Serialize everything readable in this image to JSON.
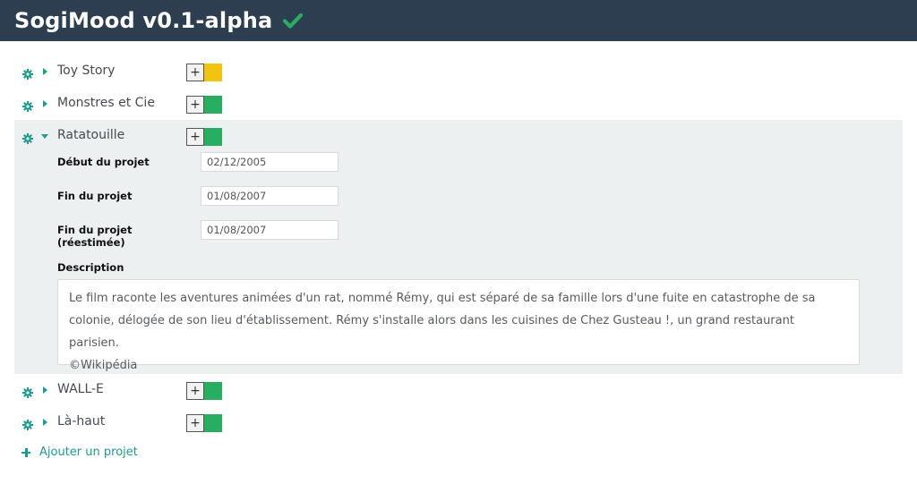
{
  "app": {
    "title": "SogiMood v0.1-alpha",
    "status_icon": "check-icon",
    "status_color": "#27ae60",
    "header_bg": "#2c3e50"
  },
  "projects": [
    {
      "name": "Toy Story",
      "expanded": false,
      "mood_color": "#f1c40f",
      "add_label": "+"
    },
    {
      "name": "Monstres et Cie",
      "expanded": false,
      "mood_color": "#27ae60",
      "add_label": "+"
    },
    {
      "name": "Ratatouille",
      "expanded": true,
      "mood_color": "#27ae60",
      "add_label": "+",
      "fields": [
        {
          "label": "Début du projet",
          "value": "02/12/2005"
        },
        {
          "label": "Fin du projet",
          "value": "01/08/2007"
        },
        {
          "label_line1": "Fin du projet",
          "label_line2": "(réestimée)",
          "value": "01/08/2007"
        }
      ],
      "description_label": "Description",
      "description_lines": [
        "Le film raconte les aventures animées d'un rat, nommé Rémy, qui est séparé de sa famille lors d'une fuite en catastrophe de sa",
        "colonie, délogée de son lieu d'établissement. Rémy s'installe alors dans les cuisines de Chez Gusteau !, un grand restaurant parisien.",
        "©Wikipédia"
      ]
    },
    {
      "name": "WALL-E",
      "expanded": false,
      "mood_color": "#27ae60",
      "add_label": "+"
    },
    {
      "name": "Là-haut",
      "expanded": false,
      "mood_color": "#27ae60",
      "add_label": "+"
    }
  ],
  "add_project": {
    "label": "Ajouter un projet",
    "icon": "plus-icon",
    "color": "#1a9c8c"
  },
  "icons": {
    "settings": "gear-icon",
    "collapsed": "caret-right-icon",
    "expanded": "caret-down-icon"
  }
}
